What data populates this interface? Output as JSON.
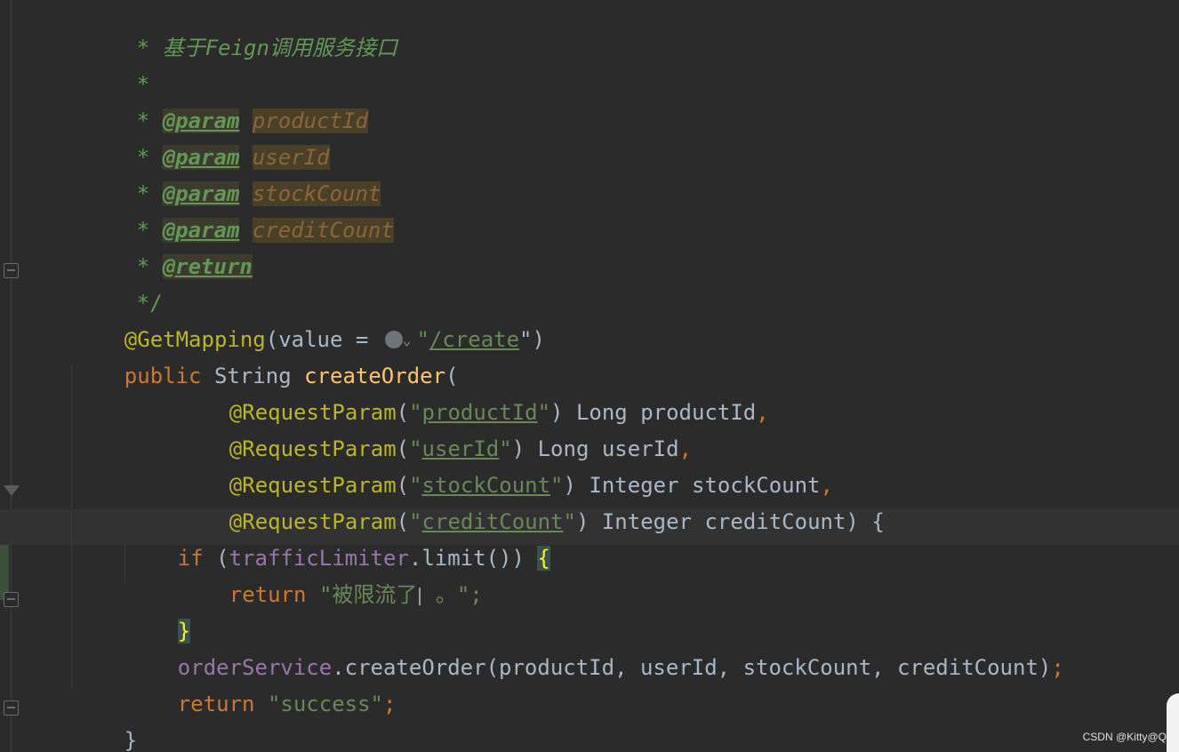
{
  "code": {
    "doc_star": "*",
    "doc_end": "*/",
    "doc_summary": "基于Feign调用服务接口",
    "param_tag": "@param",
    "return_tag": "@return",
    "params": [
      "productId",
      "userId",
      "stockCount",
      "creditCount"
    ],
    "get_mapping": "@GetMapping",
    "value_kw": "(value = ",
    "path_open_quote": "\"",
    "path": "/create",
    "path_close": "\")",
    "public_kw": "public",
    "string_type": "String",
    "method_name": "createOrder",
    "open_paren": "(",
    "request_param": "@RequestParam",
    "long_type": "Long",
    "integer_type": "Integer",
    "if_kw": "if",
    "if_open": " (",
    "traffic_limiter": "trafficLimiter",
    "limit_call": ".limit()) ",
    "open_brace": "{",
    "close_brace": "}",
    "return_kw": "return",
    "limited_msg_start": "\"被限流了",
    "limited_msg_end": "。\";",
    "order_service": "orderService",
    "create_order_call": ".createOrder(productId, userId, stockCount, creditCount)",
    "semicolon": ";",
    "success_str": "\"success\"",
    "final_brace": "}"
  },
  "watermark": "CSDN @Kitty@Q",
  "icons": {
    "url-globe": "globe-icon",
    "url-chevron": "chevron-down-icon",
    "fold": "fold-icon"
  },
  "colors": {
    "background": "#2b2b2b",
    "keyword": "#cc7832",
    "annotation": "#bbb529",
    "string": "#6a8759",
    "field": "#9876aa",
    "method": "#ffc66d",
    "comment": "#629755"
  }
}
